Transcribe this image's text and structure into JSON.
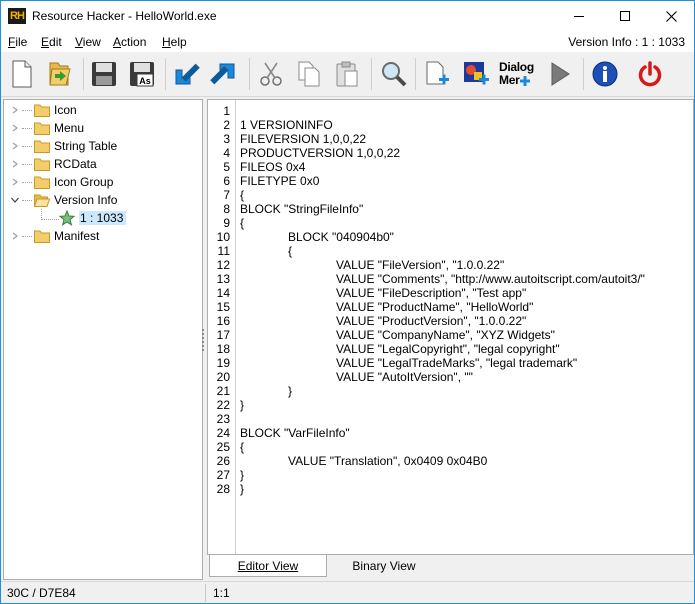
{
  "window": {
    "logo_text": "RH",
    "title": "Resource Hacker - HelloWorld.exe"
  },
  "menu": {
    "items": [
      {
        "label": "File",
        "accel": "F",
        "rest": "ile"
      },
      {
        "label": "Edit",
        "accel": "E",
        "rest": "dit"
      },
      {
        "label": "View",
        "accel": "V",
        "rest": "iew"
      },
      {
        "label": "Action",
        "accel": "A",
        "rest": "ction"
      },
      {
        "label": "Help",
        "accel": "H",
        "rest": "elp"
      }
    ],
    "resource_info": "Version Info : 1 : 1033"
  },
  "toolbar": {
    "dialog_menu_label_1": "Dialog",
    "dialog_menu_label_2": "Mer",
    "icons": [
      "new-file-icon",
      "open-file-icon",
      "save-icon",
      "save-as-icon",
      "compile-icon",
      "extract-icon",
      "cut-icon",
      "copy-icon",
      "paste-icon",
      "search-icon",
      "add-resource-icon",
      "add-image-icon",
      "dialog-menu-icon",
      "run-icon",
      "info-icon",
      "power-icon"
    ]
  },
  "tree": {
    "items": [
      {
        "label": "Icon"
      },
      {
        "label": "Menu"
      },
      {
        "label": "String Table"
      },
      {
        "label": "RCData"
      },
      {
        "label": "Icon Group"
      },
      {
        "label": "Version Info"
      },
      {
        "label": "1 : 1033"
      },
      {
        "label": "Manifest"
      }
    ]
  },
  "editor": {
    "line_numbers": [
      "1",
      "2",
      "3",
      "4",
      "5",
      "6",
      "7",
      "8",
      "9",
      "10",
      "11",
      "12",
      "13",
      "14",
      "15",
      "16",
      "17",
      "18",
      "19",
      "20",
      "21",
      "22",
      "23",
      "24",
      "25",
      "26",
      "27",
      "28"
    ],
    "lines": [
      "",
      "1 VERSIONINFO",
      "FILEVERSION 1,0,0,22",
      "PRODUCTVERSION 1,0,0,22",
      "FILEOS 0x4",
      "FILETYPE 0x0",
      "{",
      "BLOCK \"StringFileInfo\"",
      "{",
      "BLOCK \"040904b0\"",
      "{",
      "VALUE \"FileVersion\", \"1.0.0.22\"",
      "VALUE \"Comments\", \"http://www.autoitscript.com/autoit3/\"",
      "VALUE \"FileDescription\", \"Test app\"",
      "VALUE \"ProductName\", \"HelloWorld\"",
      "VALUE \"ProductVersion\", \"1.0.0.22\"",
      "VALUE \"CompanyName\", \"XYZ Widgets\"",
      "VALUE \"LegalCopyright\", \"legal copyright\"",
      "VALUE \"LegalTradeMarks\", \"legal trademark\"",
      "VALUE \"AutoItVersion\", \"\"",
      "}",
      "}",
      "",
      "BLOCK \"VarFileInfo\"",
      "{",
      "VALUE \"Translation\", 0x0409 0x04B0",
      "}",
      "}"
    ]
  },
  "tabs": {
    "editor_view": "Editor View",
    "binary_view": "Binary View"
  },
  "status": {
    "left": "30C / D7E84",
    "right": "1:1"
  }
}
